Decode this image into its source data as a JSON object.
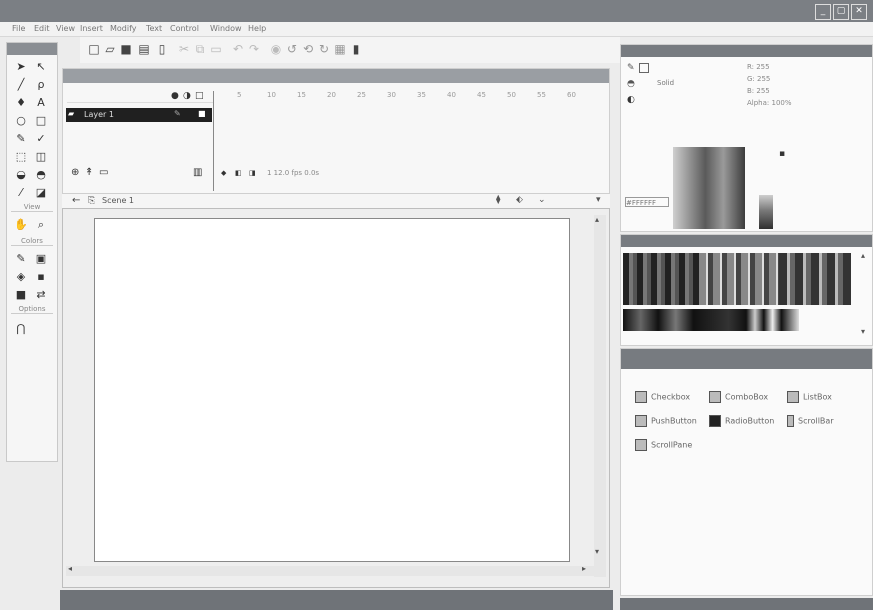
{
  "titlebar": {
    "text": "",
    "controls": [
      "_",
      "▢",
      "✕"
    ]
  },
  "menu": [
    "File",
    "Edit",
    "View",
    "Insert",
    "Modify",
    "Text",
    "Control",
    "Window",
    "Help"
  ],
  "tools_panel": {
    "sections": [
      "View",
      "Colors",
      "Options"
    ]
  },
  "timeline": {
    "layer_label": "Layer 1",
    "frame_numbers": [
      "5",
      "10",
      "15",
      "20",
      "25",
      "30",
      "35",
      "40",
      "45",
      "50",
      "55",
      "60"
    ],
    "status": "1   12.0 fps   0.0s"
  },
  "stage": {
    "scene_label": "Scene 1"
  },
  "color_mixer": {
    "type_label": "Solid",
    "alpha_label": "Alpha: 100%",
    "fields": [
      "R: 255",
      "G: 255",
      "B: 255"
    ],
    "hex": "#FFFFFF"
  },
  "library": {
    "items": [
      {
        "label": "Checkbox",
        "icon": "checkbox-icon"
      },
      {
        "label": "ComboBox",
        "icon": "combobox-icon"
      },
      {
        "label": "ListBox",
        "icon": "listbox-icon"
      },
      {
        "label": "PushButton",
        "icon": "pushbutton-icon"
      },
      {
        "label": "RadioButton",
        "icon": "radiobutton-icon"
      },
      {
        "label": "ScrollBar",
        "icon": "scrollbar-icon"
      },
      {
        "label": "ScrollPane",
        "icon": "scrollpane-icon"
      }
    ]
  },
  "colors": {
    "dark": "#6f7378",
    "panel": "#fafafa",
    "canvas": "#ffffff",
    "layer": "#202020"
  }
}
